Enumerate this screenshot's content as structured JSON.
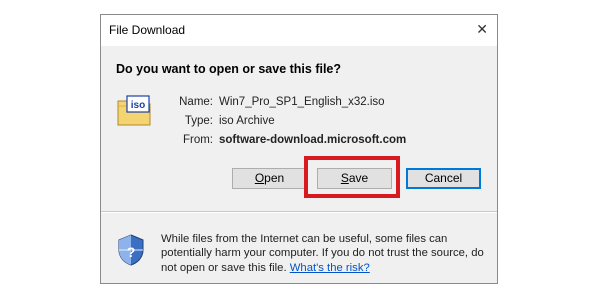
{
  "dialog": {
    "title": "File Download",
    "close_glyph": "✕",
    "heading": "Do you want to open or save this file?"
  },
  "file": {
    "icon_text": "iso",
    "name_label": "Name:",
    "name_value": "Win7_Pro_SP1_English_x32.iso",
    "type_label": "Type:",
    "type_value": "iso Archive",
    "from_label": "From:",
    "from_value": "software-download.microsoft.com"
  },
  "buttons": {
    "open": "Open",
    "save": "Save",
    "cancel": "Cancel"
  },
  "warning": {
    "text": "While files from the Internet can be useful, some files can potentially harm your computer. If you do not trust the source, do not open or save this file.",
    "link": "What's the risk?"
  },
  "colors": {
    "highlight": "#d71920",
    "link": "#0054c7",
    "default_button_border": "#0078d7"
  },
  "icons": {
    "file": "iso-file-icon",
    "security": "shield-icon",
    "close": "close-icon"
  }
}
